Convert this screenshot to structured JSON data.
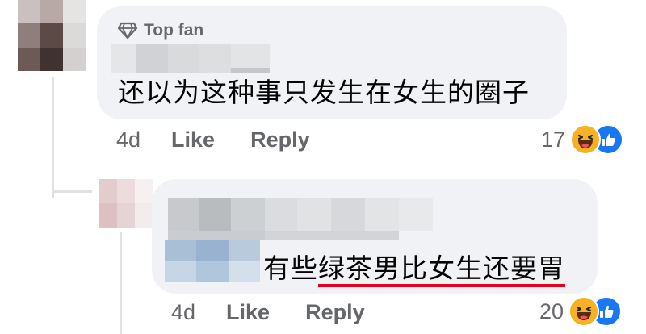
{
  "comment1": {
    "badge": "Top fan",
    "text": "还以为这种事只发生在女生的圈子",
    "time": "4d",
    "like_label": "Like",
    "reply_label": "Reply",
    "reaction_count": "17"
  },
  "comment2": {
    "text_plain": "有些",
    "text_underlined": "绿茶男比女生还要胃",
    "time": "4d",
    "like_label": "Like",
    "reply_label": "Reply",
    "reaction_count": "20"
  },
  "icons": {
    "badge": "diamond-icon",
    "reaction_1": "haha-icon",
    "reaction_2": "like-icon"
  },
  "colors": {
    "bubble": "#f0f2f5",
    "meta_text": "#65676b",
    "like_blue": "#1877f2",
    "haha_yellow": "#f7b125",
    "underline_red": "#e0001b"
  }
}
